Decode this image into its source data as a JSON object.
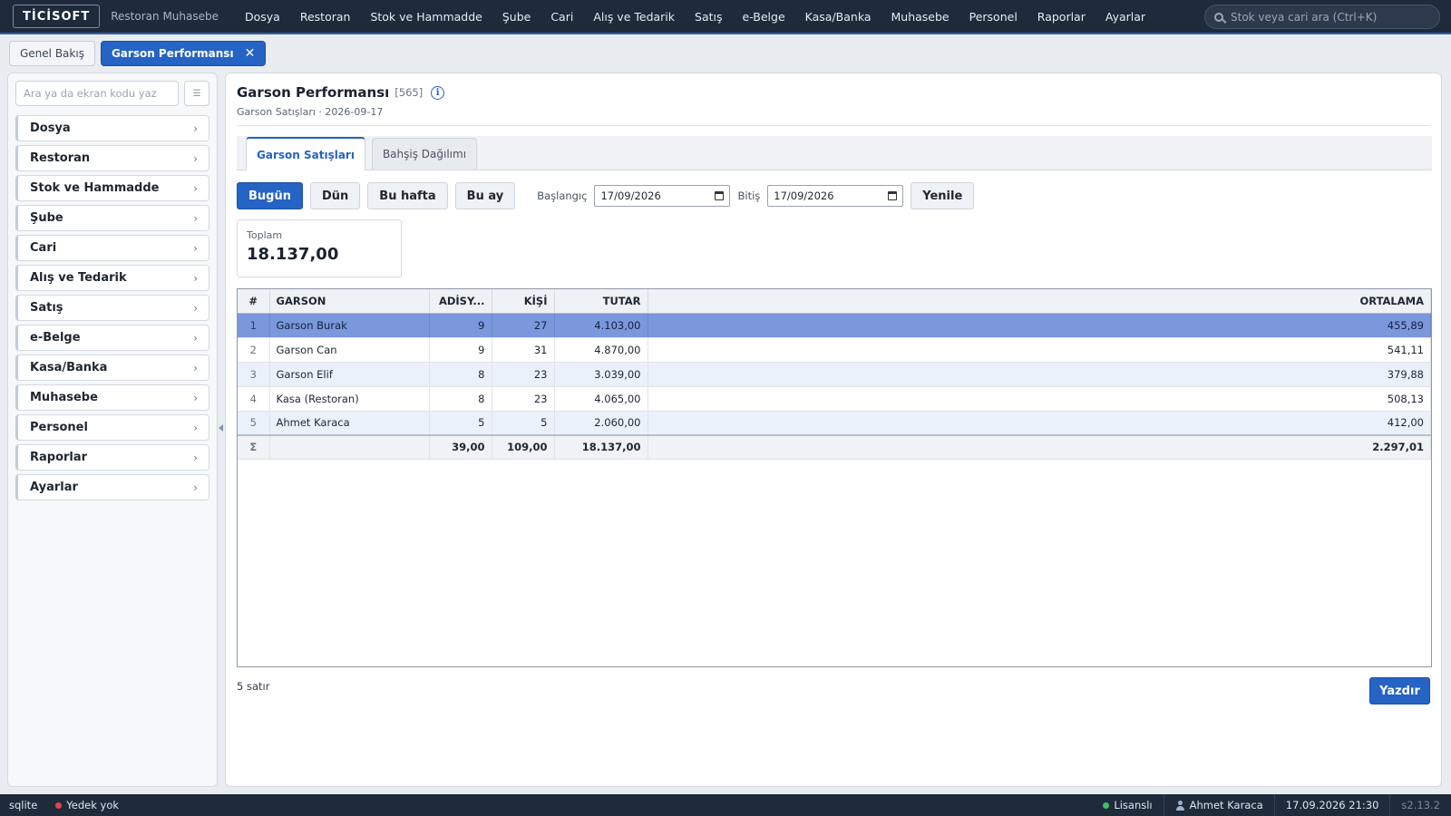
{
  "topbar": {
    "brand": "TİCİSOFT",
    "brand_sub": "Restoran Muhasebe",
    "menu": [
      "Dosya",
      "Restoran",
      "Stok ve Hammadde",
      "Şube",
      "Cari",
      "Alış ve Tedarik",
      "Satış",
      "e-Belge",
      "Kasa/Banka",
      "Muhasebe",
      "Personel",
      "Raporlar",
      "Ayarlar"
    ],
    "search_placeholder": "Stok veya cari ara (Ctrl+K)"
  },
  "page_tabs": [
    {
      "label": "Genel Bakış",
      "active": false
    },
    {
      "label": "Garson Performansı",
      "active": true
    }
  ],
  "sidebar": {
    "search_placeholder": "Ara ya da ekran kodu yaz",
    "items": [
      "Dosya",
      "Restoran",
      "Stok ve Hammadde",
      "Şube",
      "Cari",
      "Alış ve Tedarik",
      "Satış",
      "e-Belge",
      "Kasa/Banka",
      "Muhasebe",
      "Personel",
      "Raporlar",
      "Ayarlar"
    ]
  },
  "main": {
    "title": "Garson Performansı",
    "screen_code": "[565]",
    "subtitle": "Garson Satışları · 2026-09-17",
    "view_tabs": [
      {
        "label": "Garson Satışları",
        "active": true
      },
      {
        "label": "Bahşiş Dağılımı",
        "active": false
      }
    ],
    "filters": {
      "quick": [
        {
          "label": "Bugün",
          "primary": true
        },
        {
          "label": "Dün",
          "primary": false
        },
        {
          "label": "Bu hafta",
          "primary": false
        },
        {
          "label": "Bu ay",
          "primary": false
        }
      ],
      "start_label": "Başlangıç",
      "start_value": "17/09/2026",
      "end_label": "Bitiş",
      "end_value": "17/09/2026",
      "refresh_label": "Yenile"
    },
    "total": {
      "label": "Toplam",
      "value": "18.137,00"
    },
    "table": {
      "columns": [
        "#",
        "GARSON",
        "ADİSY...",
        "KİŞİ",
        "TUTAR",
        "ORTALAMA"
      ],
      "rows": [
        [
          "1",
          "Garson Burak",
          "9",
          "27",
          "4.103,00",
          "455,89"
        ],
        [
          "2",
          "Garson Can",
          "9",
          "31",
          "4.870,00",
          "541,11"
        ],
        [
          "3",
          "Garson Elif",
          "8",
          "23",
          "3.039,00",
          "379,88"
        ],
        [
          "4",
          "Kasa (Restoran)",
          "8",
          "23",
          "4.065,00",
          "508,13"
        ],
        [
          "5",
          "Ahmet Karaca",
          "5",
          "5",
          "2.060,00",
          "412,00"
        ]
      ],
      "selected_row": 0,
      "sum_row": [
        "Σ",
        "",
        "39,00",
        "109,00",
        "18.137,00",
        "2.297,01"
      ]
    },
    "row_count": "5 satır",
    "print_label": "Yazdır"
  },
  "statusbar": {
    "db": "sqlite",
    "backup": "Yedek yok",
    "backup_color": "#e0434a",
    "license": "Lisanslı",
    "license_color": "#3cc06a",
    "user": "Ahmet Karaca",
    "datetime": "17.09.2026 21:30",
    "version": "s2.13.2"
  },
  "colors": {
    "accent": "#2563c4",
    "selected_row": "#7b98dc",
    "topbar": "#1f2b3b"
  }
}
